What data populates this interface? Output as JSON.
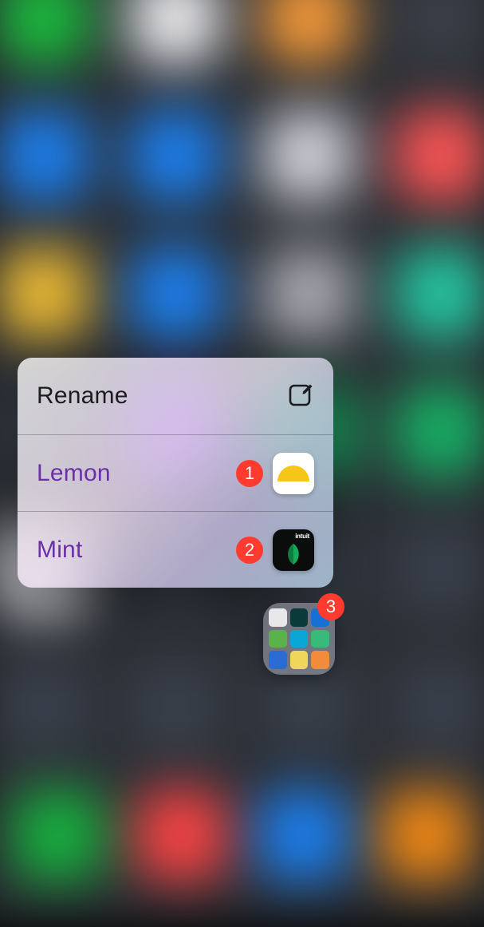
{
  "context_menu": {
    "rename_label": "Rename",
    "apps": [
      {
        "name": "Lemon",
        "badge": "1",
        "icon": "lemon"
      },
      {
        "name": "Mint",
        "badge": "2",
        "icon": "mint",
        "brand": "intuit"
      }
    ]
  },
  "folder": {
    "badge": "3",
    "mini_colors": [
      "#e8e8ea",
      "#0b3a3a",
      "#1670d6",
      "#59b34a",
      "#0aa6d6",
      "#39b97a",
      "#2a6bd4",
      "#f0d65a",
      "#f28b3b"
    ]
  },
  "background": {
    "grid_colors": [
      "#2db24a",
      "#e8e8ea",
      "#e59a4a",
      "#3b3f46",
      "#2a7bd6",
      "#2a7bd6",
      "#cfcfd6",
      "#e65a5a",
      "#e0b84a",
      "#2a7bd6",
      "#a6a6ad",
      "#39c0a0",
      "#3b4048",
      "#5a2fa8",
      "#2aa86a",
      "#2aa86a",
      "#d6d6dc",
      "#3a3f48",
      "#3a3f48",
      "#3a3f48",
      "#3a3f48",
      "#3a3f48",
      "#3a3f48",
      "#3a3f48"
    ],
    "dock_colors": [
      "#2aa84a",
      "#e04a4a",
      "#2a7bd6",
      "#e08a2a"
    ]
  }
}
